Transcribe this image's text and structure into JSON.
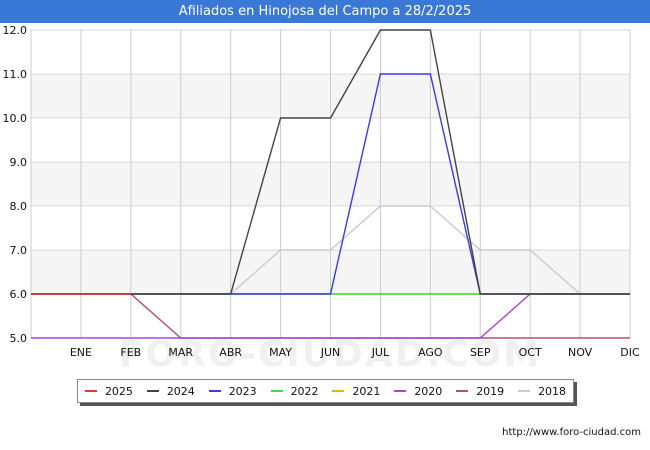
{
  "title": "Afiliados en Hinojosa del Campo a 28/2/2025",
  "source": "http://www.foro-ciudad.com",
  "watermark": "FORO-CIUDAD.COM",
  "chart_data": {
    "type": "line",
    "title": "Afiliados en Hinojosa del Campo a 28/2/2025",
    "categories": [
      "",
      "ENE",
      "FEB",
      "MAR",
      "ABR",
      "MAY",
      "JUN",
      "JUL",
      "AGO",
      "SEP",
      "OCT",
      "NOV",
      "DIC"
    ],
    "ylim": [
      5.0,
      12.0
    ],
    "yticks": [
      "5.0",
      "6.0",
      "7.0",
      "8.0",
      "9.0",
      "10.0",
      "11.0",
      "12.0"
    ],
    "grid": true,
    "legend_position": "bottom",
    "series": [
      {
        "name": "2025",
        "color": "#e8342c",
        "values": [
          6,
          6,
          6
        ]
      },
      {
        "name": "2024",
        "color": "#444444",
        "values": [
          6,
          6,
          6,
          6,
          6,
          10,
          10,
          12,
          12,
          6,
          6,
          6,
          6
        ]
      },
      {
        "name": "2023",
        "color": "#3a3af0",
        "values": [
          6,
          6,
          6,
          6,
          6,
          6,
          6,
          11,
          11,
          6,
          6,
          6,
          6
        ]
      },
      {
        "name": "2022",
        "color": "#44dd44",
        "values": [
          6,
          6,
          6,
          6,
          6,
          6,
          6,
          6,
          6,
          6,
          6,
          6,
          6
        ]
      },
      {
        "name": "2021",
        "color": "#e8b010",
        "values": [
          6,
          6,
          6,
          6,
          6,
          6,
          6,
          6,
          6,
          6,
          6,
          6,
          6
        ]
      },
      {
        "name": "2020",
        "color": "#b040e0",
        "values": [
          5,
          5,
          5,
          5,
          5,
          5,
          5,
          5,
          5,
          5,
          6,
          6,
          6
        ]
      },
      {
        "name": "2019",
        "color": "#b05070",
        "values": [
          6,
          6,
          6,
          5,
          5,
          5,
          5,
          5,
          5,
          5,
          5,
          5,
          5
        ]
      },
      {
        "name": "2018",
        "color": "#cccccc",
        "values": [
          6,
          6,
          6,
          6,
          6,
          7,
          7,
          8,
          8,
          7,
          7,
          6,
          6
        ]
      }
    ]
  }
}
